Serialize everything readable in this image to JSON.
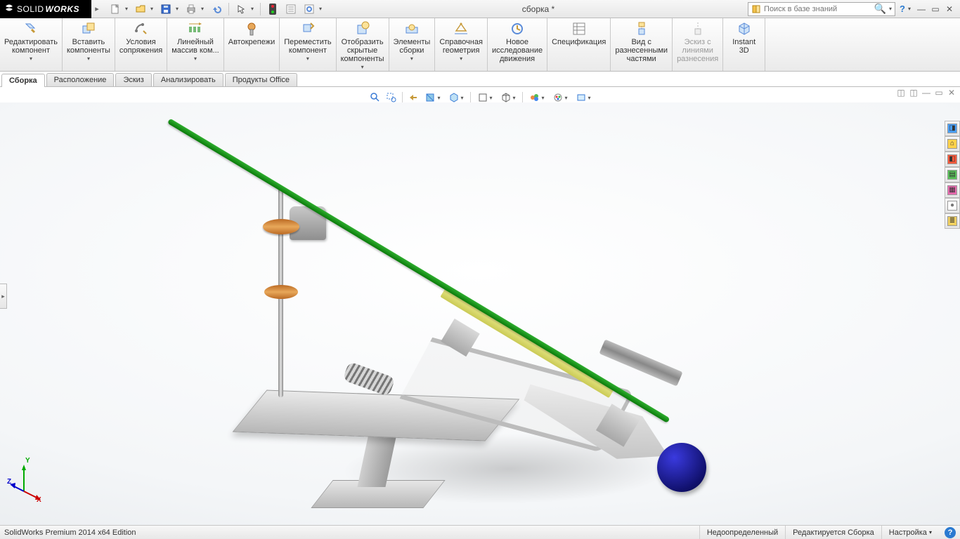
{
  "app": {
    "brand_prefix": "SOLID",
    "brand_suffix": "WORKS",
    "doc_title": "сборка *",
    "search_placeholder": "Поиск в базе знаний"
  },
  "qat": {
    "icons": [
      "new",
      "open",
      "save",
      "print",
      "undo",
      "select",
      "rebuild-light",
      "options",
      "rebuild"
    ]
  },
  "ribbon": [
    {
      "id": "edit-component",
      "label": "Редактировать\nкомпонент",
      "dd": true
    },
    {
      "id": "insert-components",
      "label": "Вставить\nкомпоненты",
      "dd": true
    },
    {
      "id": "mate",
      "label": "Условия\nсопряжения",
      "dd": false
    },
    {
      "id": "linear-pattern",
      "label": "Линейный\nмассив ком...",
      "dd": true
    },
    {
      "id": "smart-fasteners",
      "label": "Автокрепежи",
      "dd": false
    },
    {
      "id": "move-component",
      "label": "Переместить\nкомпонент",
      "dd": true
    },
    {
      "id": "show-hidden",
      "label": "Отобразить\nскрытые\nкомпоненты",
      "dd": true
    },
    {
      "id": "assembly-features",
      "label": "Элементы\nсборки",
      "dd": true
    },
    {
      "id": "ref-geometry",
      "label": "Справочная\nгеометрия",
      "dd": true
    },
    {
      "id": "motion-study",
      "label": "Новое\nисследование\nдвижения",
      "dd": false
    },
    {
      "id": "bom",
      "label": "Спецификация",
      "dd": false
    },
    {
      "id": "exploded-view",
      "label": "Вид с\nразнесенными\nчастями",
      "dd": false
    },
    {
      "id": "explode-sketch",
      "label": "Эскиз с\nлиниями\nразнесения",
      "dd": false,
      "disabled": true
    },
    {
      "id": "instant3d",
      "label": "Instant\n3D",
      "dd": false
    }
  ],
  "tabs": [
    {
      "id": "assembly",
      "label": "Сборка",
      "active": true
    },
    {
      "id": "layout",
      "label": "Расположение"
    },
    {
      "id": "sketch",
      "label": "Эскиз"
    },
    {
      "id": "evaluate",
      "label": "Анализировать"
    },
    {
      "id": "office",
      "label": "Продукты Office"
    }
  ],
  "view_toolbar": [
    "zoom-fit",
    "zoom-area",
    "prev-view",
    "section",
    "display-style",
    "hlr",
    "viewports",
    "render",
    "hide-show",
    "appearance",
    "scene",
    "settings"
  ],
  "side_panel": [
    {
      "name": "panel-toggle",
      "glyph": "◨",
      "bg": "#4aa3ff"
    },
    {
      "name": "home-icon",
      "glyph": "⌂",
      "bg": "#ffd24a"
    },
    {
      "name": "appearances-icon",
      "glyph": "◧",
      "bg": "#ff5a3c"
    },
    {
      "name": "decals-icon",
      "glyph": "▤",
      "bg": "#5ac35a"
    },
    {
      "name": "custom-props-icon",
      "glyph": "▦",
      "bg": "#e96bb0"
    },
    {
      "name": "render-tools-icon",
      "glyph": "●",
      "bg": "#ffffff"
    },
    {
      "name": "forum-icon",
      "glyph": "≣",
      "bg": "#f0d060"
    }
  ],
  "triad": {
    "x": "X",
    "y": "Y",
    "z": "Z"
  },
  "status": {
    "edition": "SolidWorks Premium 2014 x64 Edition",
    "state": "Недоопределенный",
    "mode": "Редактируется Сборка",
    "custom": "Настройка"
  },
  "colors": {
    "green": "#18a018",
    "blue": "#1a1a9c",
    "orange": "#cc7a2e",
    "steel": "#bfbfbf"
  }
}
